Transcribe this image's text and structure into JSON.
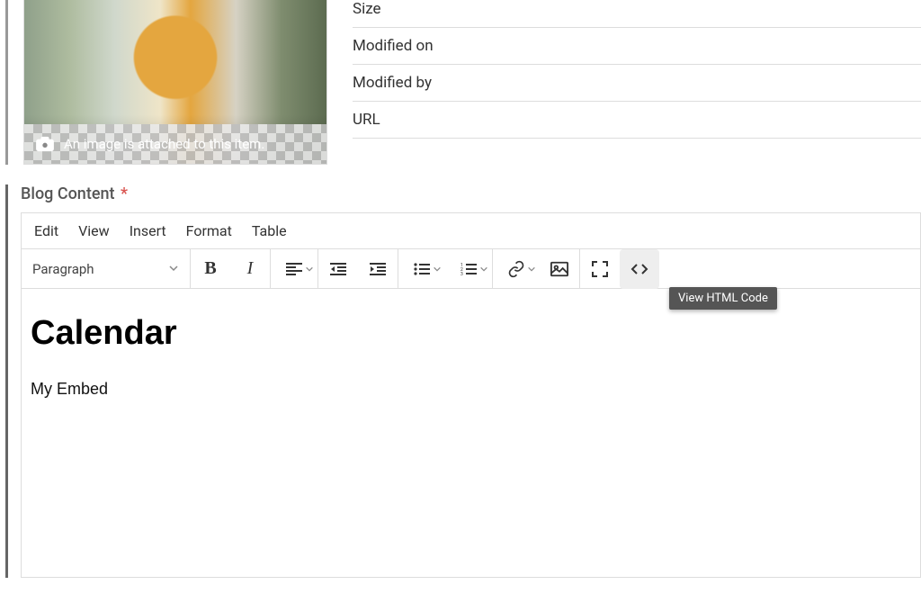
{
  "attachment": {
    "caption": "An image is attached to this item."
  },
  "meta": {
    "size_label": "Size",
    "modified_on_label": "Modified on",
    "modified_by_label": "Modified by",
    "url_label": "URL"
  },
  "blog": {
    "label": "Blog Content",
    "required_mark": "*"
  },
  "menu": {
    "edit": "Edit",
    "view": "View",
    "insert": "Insert",
    "format": "Format",
    "table": "Table"
  },
  "toolbar": {
    "paragraph_selector": "Paragraph",
    "icons": {
      "bold": "bold-icon",
      "italic": "italic-icon",
      "align": "align-left-icon",
      "outdent": "outdent-icon",
      "indent": "indent-icon",
      "bullets": "bullet-list-icon",
      "numbers": "numbered-list-icon",
      "link": "link-icon",
      "image": "image-icon",
      "fullscreen": "fullscreen-icon",
      "code": "code-icon"
    }
  },
  "tooltip": {
    "view_html": "View HTML Code"
  },
  "content": {
    "heading": "Calendar",
    "paragraph": "My Embed"
  }
}
